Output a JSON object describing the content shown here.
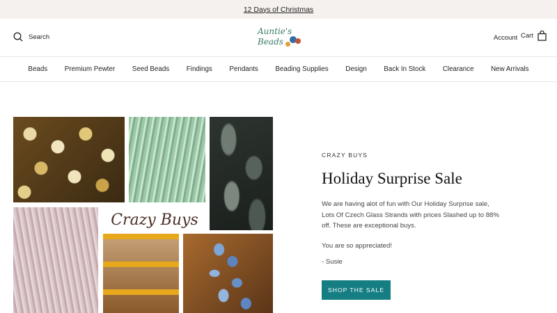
{
  "announcement": {
    "text": "12 Days of Christmas"
  },
  "header": {
    "search_label": "Search",
    "logo": {
      "line1": "Auntie's",
      "line2": "Beads"
    },
    "account_label": "Account",
    "cart_label": "Cart"
  },
  "nav": {
    "items": [
      {
        "label": "Beads"
      },
      {
        "label": "Premium Pewter"
      },
      {
        "label": "Seed Beads"
      },
      {
        "label": "Findings"
      },
      {
        "label": "Pendants"
      },
      {
        "label": "Beading Supplies"
      },
      {
        "label": "Design"
      },
      {
        "label": "Back In Stock"
      },
      {
        "label": "Clearance"
      },
      {
        "label": "New Arrivals"
      }
    ]
  },
  "collage": {
    "overlay_text": "Crazy Buys"
  },
  "promo": {
    "eyebrow": "CRAZY BUYS",
    "heading": "Holiday Surprise Sale",
    "body1": "We are having alot of fun with Our Holiday Surprise sale, Lots Of Czech Glass Strands with prices Slashed up to 88% off. These are exceptional buys.",
    "body2": "You are so appreciated!",
    "body3": "- Susie",
    "cta_label": "SHOP THE SALE"
  },
  "colors": {
    "accent": "#157e83",
    "announcement_bg": "#f5f1ee"
  }
}
